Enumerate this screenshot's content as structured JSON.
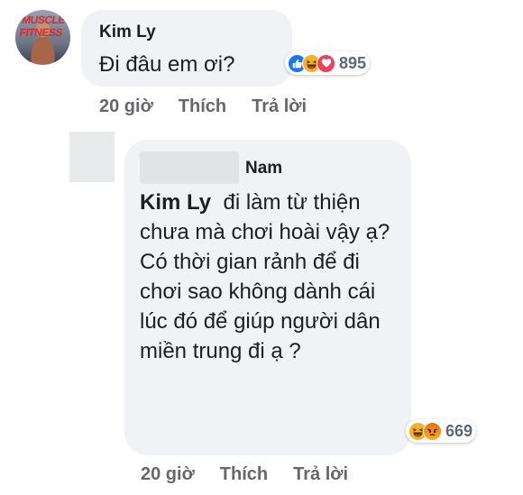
{
  "comments": [
    {
      "author": "Kim Ly",
      "text": "Đi đâu em ơi?",
      "reactions": {
        "icons": [
          "like-icon",
          "haha-icon",
          "love-icon"
        ],
        "count": "895"
      },
      "time": "20 giờ",
      "like_label": "Thích",
      "reply_label": "Trả lời"
    },
    {
      "author": "Nam",
      "mention": "Kim Ly",
      "text": "đi làm từ thiện chưa mà chơi hoài vậy ạ? Có thời gian rảnh để đi chơi sao không dành cái lúc đó để giúp người dân miền trung đi ạ ?",
      "reactions": {
        "icons": [
          "haha-icon",
          "angry-icon"
        ],
        "count": "669"
      },
      "time": "20 giờ",
      "like_label": "Thích",
      "reply_label": "Trả lời"
    }
  ],
  "avatar_logo_text": "MUSCLE FITNESS"
}
